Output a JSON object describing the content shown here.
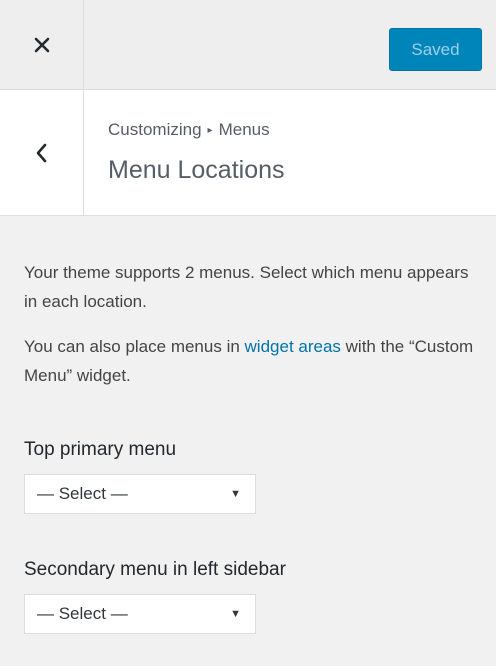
{
  "header": {
    "close_icon": "close-icon",
    "saved_label": "Saved"
  },
  "section": {
    "back_icon": "chevron-left-icon",
    "breadcrumb_parent": "Customizing",
    "breadcrumb_sep": "▸",
    "breadcrumb_current": "Menus",
    "title": "Menu Locations"
  },
  "content": {
    "desc1": "Your theme supports 2 menus. Select which menu appears in each location.",
    "desc2_before": "You can also place menus in ",
    "desc2_link": "widget areas",
    "desc2_after": " with the “Custom Menu” widget.",
    "locations": [
      {
        "label": "Top primary menu",
        "selected": "— Select —"
      },
      {
        "label": "Secondary menu in left sidebar",
        "selected": "— Select —"
      }
    ]
  },
  "colors": {
    "accent": "#0085ba",
    "link": "#0073aa",
    "panel_bg": "#f1f1f1"
  }
}
